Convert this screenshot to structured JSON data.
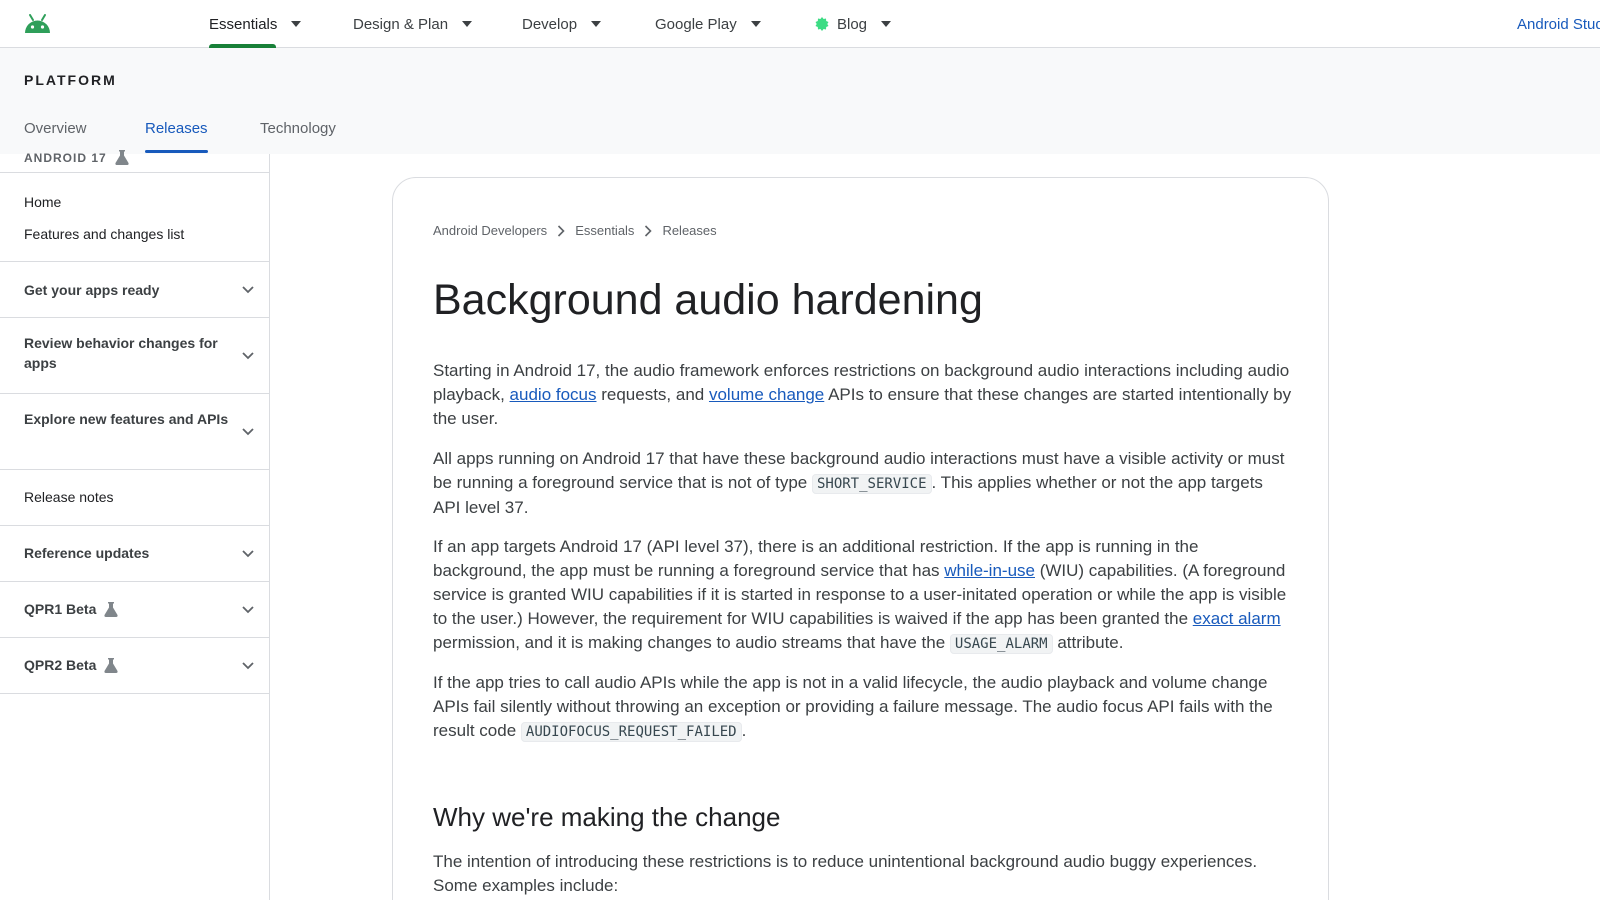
{
  "topnav": {
    "items": [
      {
        "label": "Essentials"
      },
      {
        "label": "Design & Plan"
      },
      {
        "label": "Develop"
      },
      {
        "label": "Google Play"
      },
      {
        "label": "Blog"
      }
    ],
    "studio_link": "Android Stud"
  },
  "subheader": {
    "platform": "PLATFORM",
    "tabs": [
      {
        "label": "Overview"
      },
      {
        "label": "Releases"
      },
      {
        "label": "Technology"
      }
    ]
  },
  "sidebar": {
    "version": "ANDROID 17",
    "links": [
      "Home",
      "Features and changes list",
      "Release notes"
    ],
    "sections": [
      {
        "label": "Get your apps ready"
      },
      {
        "label": "Review behavior changes for apps"
      },
      {
        "label": "Explore new features and APIs"
      },
      {
        "label": "Reference updates"
      },
      {
        "label": "QPR1 Beta"
      },
      {
        "label": "QPR2 Beta"
      }
    ]
  },
  "breadcrumb": [
    "Android Developers",
    "Essentials",
    "Releases"
  ],
  "article": {
    "title": "Background audio hardening",
    "p1": {
      "a": "Starting in Android 17, the audio framework enforces restrictions on background audio interactions including audio playback, ",
      "link1": "audio focus",
      "b": " requests, and ",
      "link2": "volume change",
      "c": " APIs to ensure that these changes are started intentionally by the user."
    },
    "p2": {
      "a": "All apps running on Android 17 that have these background audio interactions must have a visible activity or must be running a foreground service that is not of type ",
      "code": "SHORT_SERVICE",
      "b": ". This applies whether or not the app targets API level 37."
    },
    "p3": {
      "a": "If an app targets Android 17 (API level 37), there is an additional restriction. If the app is running in the background, the app must be running a foreground service that has ",
      "link1": "while-in-use",
      "b": " (WIU) capabilities. (A foreground service is granted WIU capabilities if it is started in response to a user-initated operation or while the app is visible to the user.) However, the requirement for WIU capabilities is waived if the app has been granted the ",
      "link2": "exact alarm",
      "c": " permission, and it is making changes to audio streams that have the ",
      "code": "USAGE_ALARM",
      "d": " attribute."
    },
    "p4": {
      "a": "If the app tries to call audio APIs while the app is not in a valid lifecycle, the audio playback and volume change APIs fail silently without throwing an exception or providing a failure message. The audio focus API fails with the result code ",
      "code": "AUDIOFOCUS_REQUEST_FAILED",
      "b": "."
    },
    "heading2": "Why we're making the change",
    "p5": "The intention of introducing these restrictions is to reduce unintentional background audio buggy experiences. Some examples include:"
  },
  "colors": {
    "link": "#185abc",
    "active_nav": "#188038",
    "android_green": "#3ddc84"
  }
}
